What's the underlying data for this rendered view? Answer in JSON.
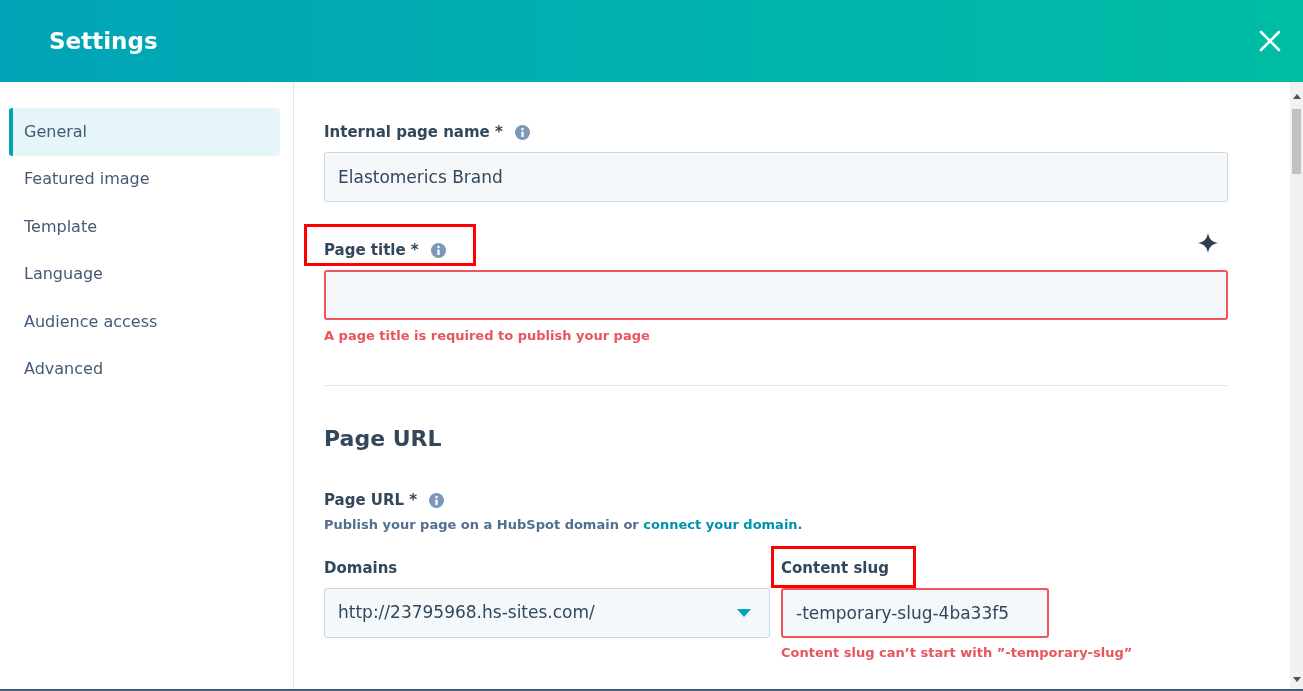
{
  "header": {
    "title": "Settings"
  },
  "sidebar": {
    "items": [
      {
        "label": "General",
        "selected": true
      },
      {
        "label": "Featured image",
        "selected": false
      },
      {
        "label": "Template",
        "selected": false
      },
      {
        "label": "Language",
        "selected": false
      },
      {
        "label": "Audience access",
        "selected": false
      },
      {
        "label": "Advanced",
        "selected": false
      }
    ]
  },
  "general": {
    "internal_page_name": {
      "label": "Internal page name *",
      "value": "Elastomerics Brand",
      "invalid": false
    },
    "page_title": {
      "label": "Page title *",
      "invalid": true,
      "highlighted": true,
      "error": "A page title is required to publish your page"
    }
  },
  "page_url": {
    "heading": "Page URL",
    "label": "Page URL *",
    "description": "Publish your page on a HubSpot domain or",
    "link": "connect your domain.",
    "domains": {
      "label": "Domains",
      "value": "http://23795968.hs-sites.com/"
    },
    "content_slug": {
      "label": "Content slug",
      "value": "-temporary-slug-4ba33f5",
      "invalid": true,
      "highlighted": true,
      "error": "Content slug can’t start with ”-temporary-slug”"
    }
  }
}
